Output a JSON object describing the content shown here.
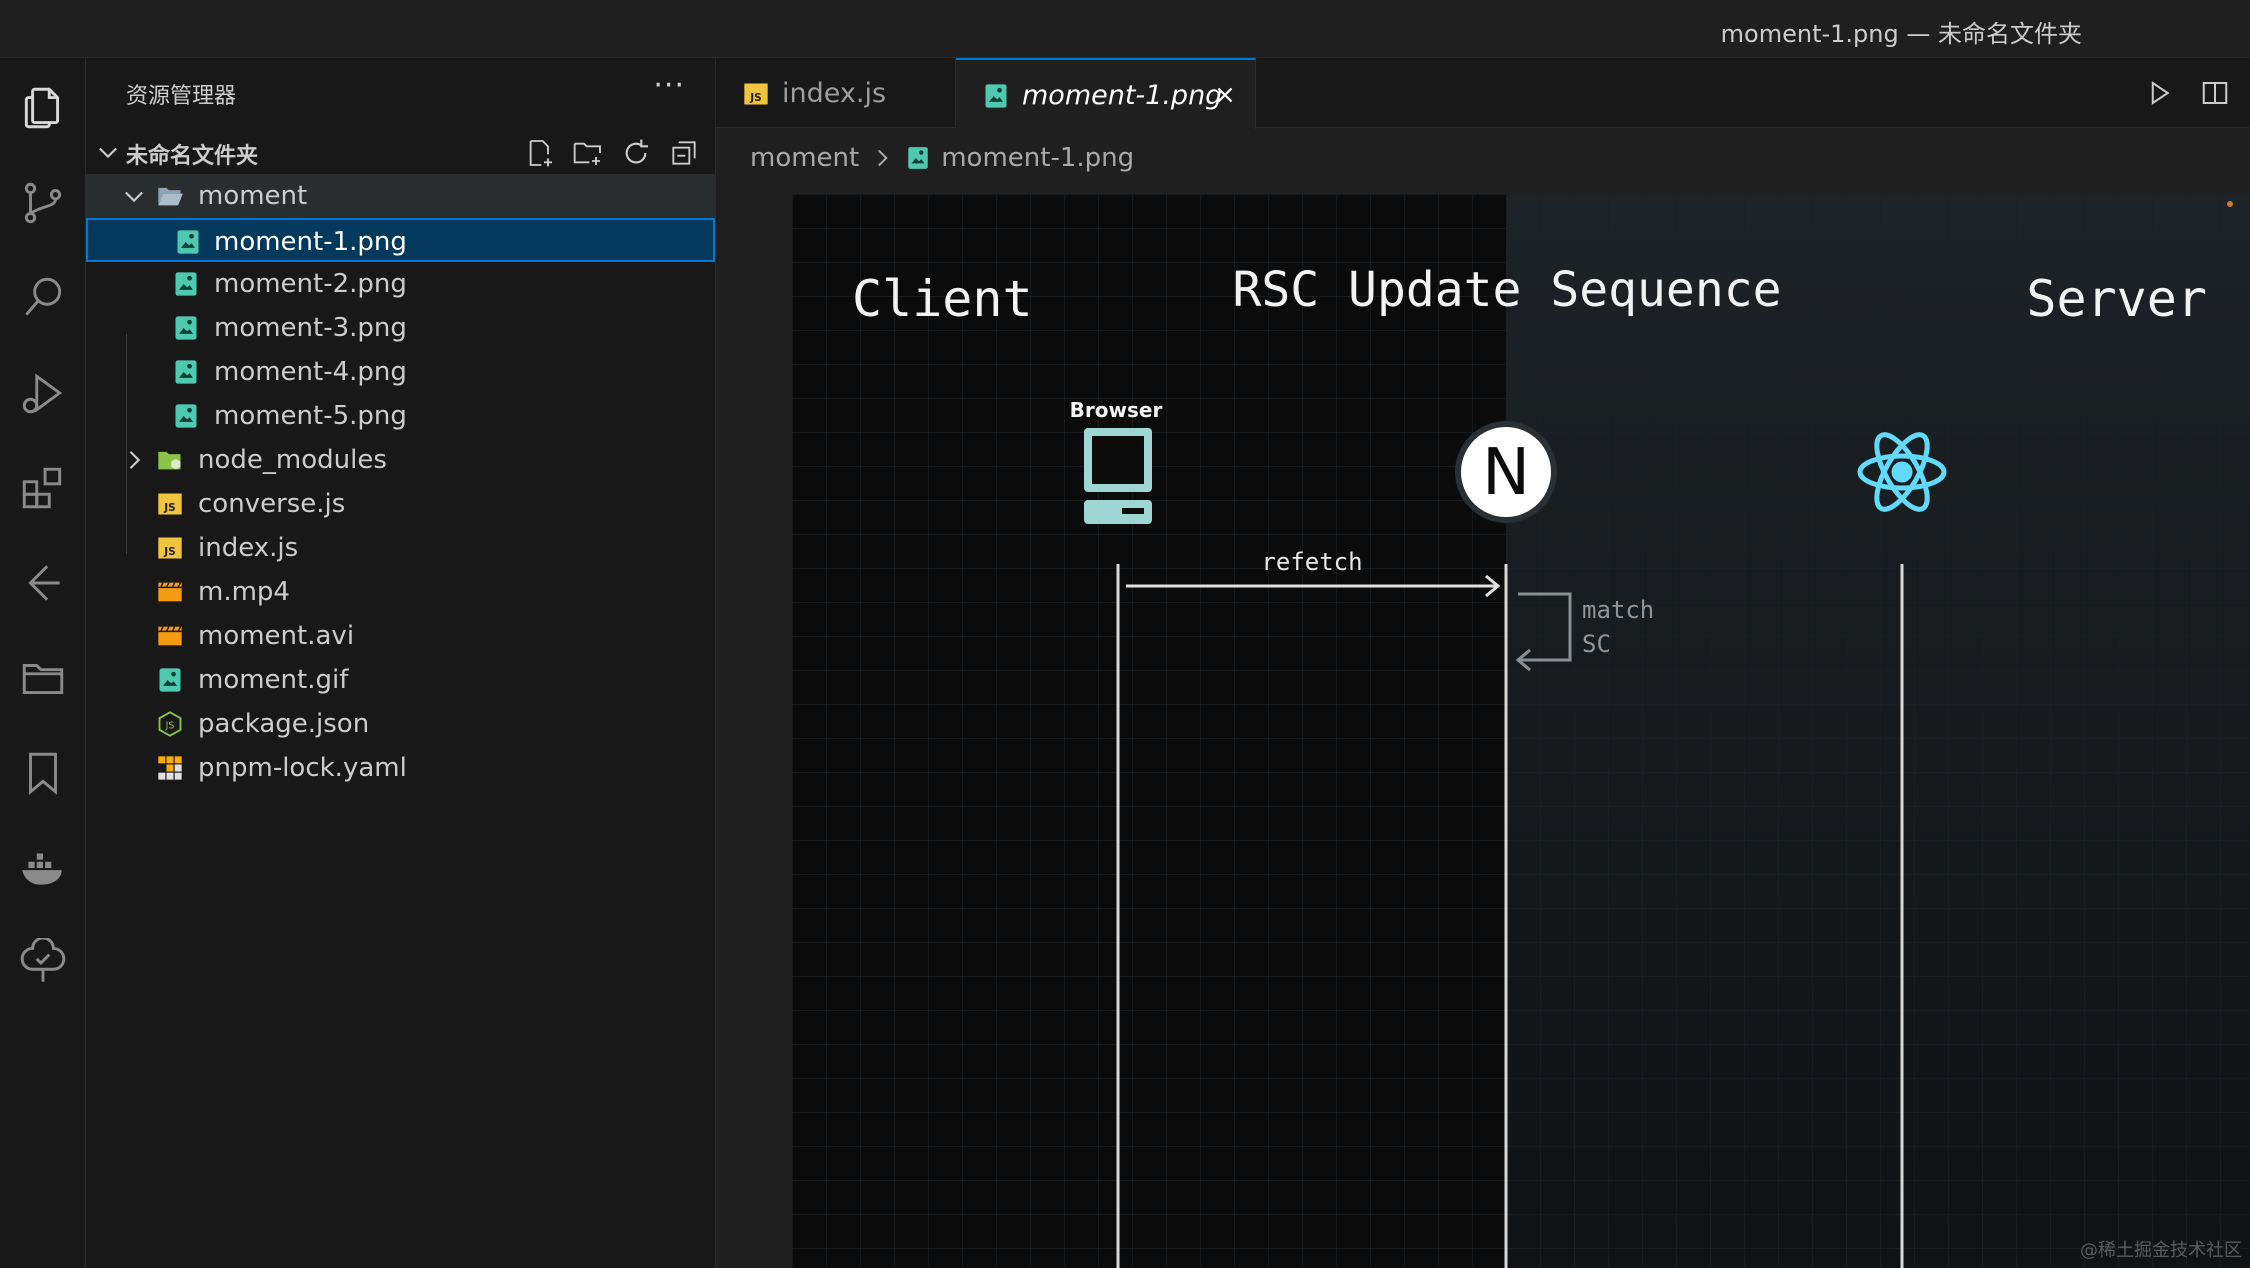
{
  "window": {
    "title": "moment-1.png — 未命名文件夹"
  },
  "activity_bar": {
    "icons": [
      "explorer-icon",
      "source-control-icon",
      "search-icon",
      "run-debug-icon",
      "extensions-icon",
      "remote-explorer-icon",
      "folder-icon",
      "bookmark-icon",
      "docker-icon",
      "tree-check-icon"
    ]
  },
  "sidebar": {
    "header": "资源管理器",
    "more": "···",
    "workspace_folder": "未命名文件夹",
    "tree": [
      {
        "label": "moment",
        "type": "folder-open"
      },
      {
        "label": "moment-1.png",
        "type": "image",
        "selected": true
      },
      {
        "label": "moment-2.png",
        "type": "image"
      },
      {
        "label": "moment-3.png",
        "type": "image"
      },
      {
        "label": "moment-4.png",
        "type": "image"
      },
      {
        "label": "moment-5.png",
        "type": "image"
      },
      {
        "label": "node_modules",
        "type": "folder-closed"
      },
      {
        "label": "converse.js",
        "type": "js"
      },
      {
        "label": "index.js",
        "type": "js"
      },
      {
        "label": "m.mp4",
        "type": "video"
      },
      {
        "label": "moment.avi",
        "type": "video"
      },
      {
        "label": "moment.gif",
        "type": "image"
      },
      {
        "label": "package.json",
        "type": "node"
      },
      {
        "label": "pnpm-lock.yaml",
        "type": "pnpm"
      }
    ]
  },
  "tabs": [
    {
      "label": "index.js",
      "type": "js",
      "active": false
    },
    {
      "label": "moment-1.png",
      "type": "image",
      "active": true
    }
  ],
  "breadcrumb": {
    "folder": "moment",
    "file": "moment-1.png"
  },
  "image": {
    "client_label": "Client",
    "title": "RSC Update Sequence",
    "server_label": "Server",
    "browser_label": "Browser",
    "next_logo": "N",
    "arrow_label": "refetch",
    "match_line1": "match",
    "match_line2": "SC",
    "watermark": "@稀土掘金技术社区"
  },
  "colors": {
    "accent": "#0078d4",
    "image_icon": "#4ec9b0",
    "js_badge": "#f0c43c",
    "video": "#f39c12",
    "react": "#61dafb"
  }
}
